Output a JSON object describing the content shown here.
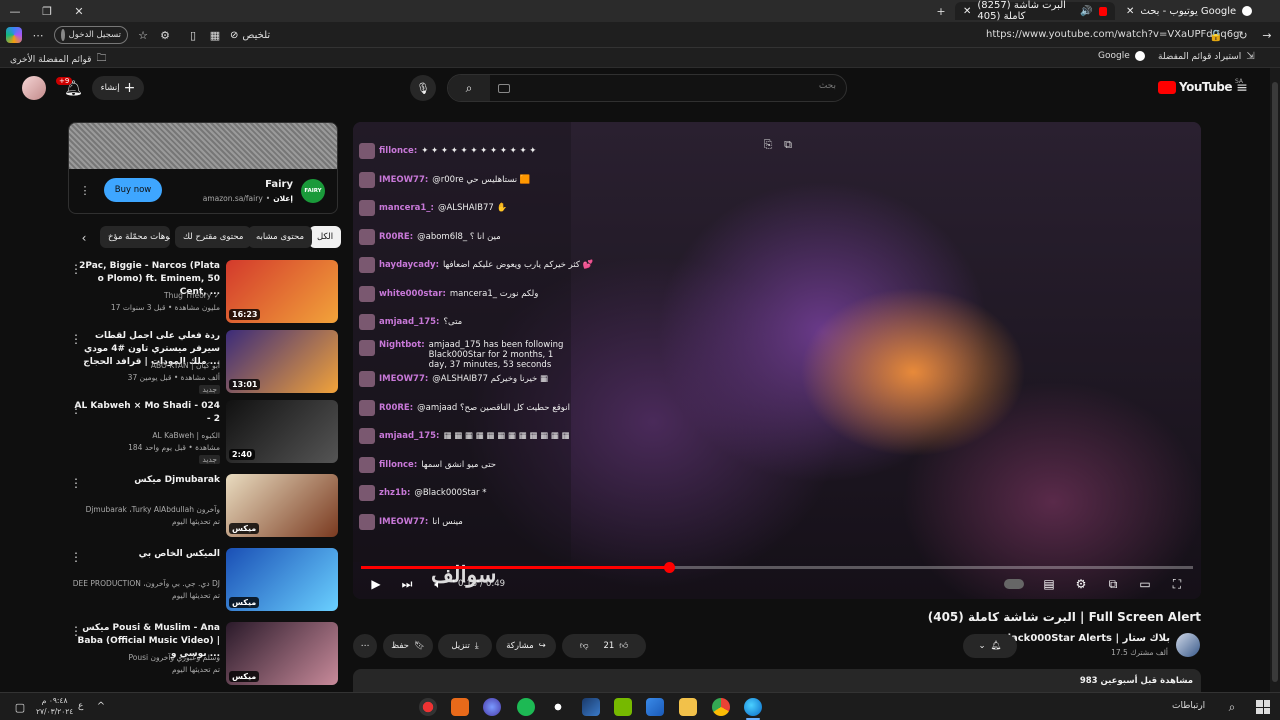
{
  "browser": {
    "tabs": [
      {
        "label": "يوتيوب - بحث Google",
        "active": false
      },
      {
        "label": "(8257) البرت شاشة كاملة (405",
        "active": true
      }
    ],
    "signin_label": "تسجيل الدخول",
    "summarize_label": "تلخيص",
    "url": "https://www.youtube.com/watch?v=VXaUPFdGq6g",
    "bookmarks": {
      "import_label": "استيراد قوائم المفضلة",
      "google_label": "Google",
      "other_label": "قوائم المفضلة الأخرى"
    }
  },
  "youtube": {
    "logo_text": "YouTube",
    "region": "SA",
    "search_placeholder": "بحث",
    "create_label": "إنشاء",
    "notif_badge": "+9"
  },
  "ad": {
    "title": "Fairy",
    "logo_text": "FAIRY",
    "sponsor_prefix": "إعلان",
    "domain": "amazon.sa/fairy",
    "cta": "Buy now"
  },
  "chips": [
    "الكل",
    "محتوى مشابه",
    "محتوى مقترح لك",
    "فيديوهات محمّلة مؤخ"
  ],
  "recommendations": [
    {
      "title": "2Pac, Biggie - Narcos (Plata o Plomo) ft. Eminem, 50 Cent, ...",
      "channel": "Thug Theory ✓",
      "meta": "17 مليون مشاهدة • قبل 3 سنوات",
      "duration": "16:23",
      "badge": "",
      "colors": [
        "#d33a2c",
        "#f2a33a"
      ]
    },
    {
      "title": "ردة فعلي على اجمل لقطات سيرفر ميستري تاون #4 مودي ملك المودات | قرافد الحجاج ...",
      "channel": "ABO KYAN | أبو كيان",
      "meta": "37 ألف مشاهدة • قبل يومين",
      "duration": "13:01",
      "badge": "جديد",
      "colors": [
        "#3b2b7a",
        "#f2a33a"
      ]
    },
    {
      "title": "AL Kabweh × Mo Shadi - 024 - 2",
      "channel": "AL KaBweh | الكبوه",
      "meta": "184 مشاهدة • قبل يوم واحد",
      "duration": "2:40",
      "badge": "جديد",
      "colors": [
        "#111111",
        "#555555"
      ]
    },
    {
      "title": "ميكس Djmubarak",
      "channel": "Djmubarak ،Turky AlAbdullah وآخرون",
      "meta": "تم تحديثها اليوم",
      "duration": "ميكس",
      "badge": "",
      "colors": [
        "#e9dcc0",
        "#7a3a20"
      ]
    },
    {
      "title": "الميكس الخاص بي",
      "channel": "DEE PRODUCTION ،دي. جي. بي وآخرون DJ",
      "meta": "تم تحديثها اليوم",
      "duration": "ميكس",
      "badge": "",
      "colors": [
        "#1a4fb5",
        "#6ad0ff"
      ]
    },
    {
      "title": "ميكس Pousi & Muslim - Ana Baba (Official Music Video) | بوسي و ...",
      "channel": "Pousi وسلم وعبوري وآخرون",
      "meta": "تم تحديثها اليوم",
      "duration": "ميكس",
      "badge": "",
      "colors": [
        "#2a1a2a",
        "#c88a9a"
      ]
    }
  ],
  "video": {
    "title": "البرت شاشة كاملة (405) | Full Screen Alert",
    "current_time": "0:18",
    "total_time": "0:49",
    "progress": 0.37,
    "channel_name": "Black000Star Alerts | بلاك ستار",
    "subscribers": "17.5 ألف مشترك",
    "likes": "21",
    "share_label": "مشاركة",
    "download_label": "تنزيل",
    "save_label": "حفظ",
    "views_meta": "983 مشاهدة قبل أسبوعين",
    "watermark": "سوالف"
  },
  "chat": [
    {
      "name": "fillonce:",
      "msg": "✦ ✦ ✦ ✦ ✦ ✦ ✦ ✦ ✦ ✦ ✦ ✦"
    },
    {
      "name": "IMEOW77:",
      "msg": "@r00re نستاهليس حي 🟧"
    },
    {
      "name": "mancera1_:",
      "msg": "@ALSHAIB77 ✋"
    },
    {
      "name": "R00RE:",
      "msg": "@abom6l8_ مين انا ؟"
    },
    {
      "name": "haydaycady:",
      "msg": "كثر خيركم يارب ويعوض عليكم اضعافها 💕"
    },
    {
      "name": "white000star:",
      "msg": "mancera1_ ولكم نورت"
    },
    {
      "name": "amjaad_175:",
      "msg": "متى؟"
    },
    {
      "name": "Nightbot:",
      "msg": "amjaad_175 has been following Black000Star for 2 months, 1 day, 37 minutes, 53 seconds"
    },
    {
      "name": "IMEOW77:",
      "msg": "@ALSHAIB77 خيرنا وخيركم ▦"
    },
    {
      "name": "R00RE:",
      "msg": "@amjaad انوقع حطيت كل الناقصين صح؟"
    },
    {
      "name": "amjaad_175:",
      "msg": "▦ ▦ ▦ ▦ ▦ ▦ ▦ ▦ ▦ ▦ ▦ ▦"
    },
    {
      "name": "fillonce:",
      "msg": "حتى ميو انشق اسمها"
    },
    {
      "name": "zhz1b:",
      "msg": "@Black000Star *"
    },
    {
      "name": "IMEOW77:",
      "msg": "مينس انا"
    }
  ],
  "taskbar": {
    "time": "٠٩:٤٨ م",
    "date": "٢٧/٠٣/٢٠٢٤",
    "lang": "ع",
    "connections_label": "ارتباطات"
  }
}
